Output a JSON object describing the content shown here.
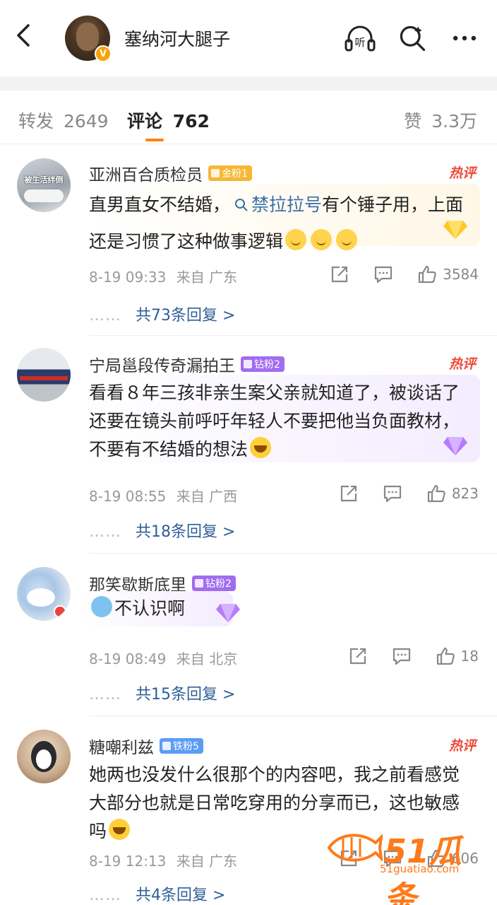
{
  "header": {
    "title": "塞纳河大腿子",
    "listen_label": "听",
    "colors": {
      "accent": "#ff8200",
      "vip": "#f6a30a"
    }
  },
  "tabs": {
    "repost_label": "转发",
    "repost_count": "2649",
    "comment_label": "评论",
    "comment_count": "762",
    "like_label": "赞",
    "like_count": "3.3万"
  },
  "comments": [
    {
      "name": "亚洲百合质检员",
      "badge": "金粉1",
      "badge_color": "#f7b733",
      "hot": "热评",
      "avatar_label": "被生活绊倒",
      "text_pre": "直男直女不结婚，",
      "topic": "禁拉拉号",
      "text_post": "有个锤子用，上面还是习惯了这种做事逻辑",
      "time": "8-19 09:33",
      "location": "来自 广东",
      "likes": "3584",
      "replies": "共73条回复 >"
    },
    {
      "name": "宁局邕段传奇漏拍王",
      "badge": "钻粉2",
      "badge_color": "#a26cf0",
      "hot": "热评",
      "text": "看看８年三孩非亲生案父亲就知道了，被谈话了还要在镜头前呼吁年轻人不要把他当负面教材，不要有不结婚的想法",
      "time": "8-19 08:55",
      "location": "来自 广西",
      "likes": "823",
      "replies": "共18条回复 >"
    },
    {
      "name": "那笑歇斯底里",
      "badge": "钻粉2",
      "badge_color": "#a26cf0",
      "text": "不认识啊",
      "time": "8-19 08:49",
      "location": "来自 北京",
      "likes": "18",
      "replies": "共15条回复 >"
    },
    {
      "name": "糖嘲利兹",
      "badge": "铁粉5",
      "badge_color": "#5b9cf5",
      "hot": "热评",
      "text": "她两也没发什么很那个的内容吧，我之前看感觉大部分也就是日常吃穿用的分享而已，这也敏感吗",
      "time": "8-19 12:13",
      "location": "来自 广东",
      "likes": "606",
      "replies": "共4条回复 >"
    }
  ],
  "reply_dots": "……",
  "watermark": {
    "brand": "51瓜条",
    "url": "51guatiao.com"
  }
}
